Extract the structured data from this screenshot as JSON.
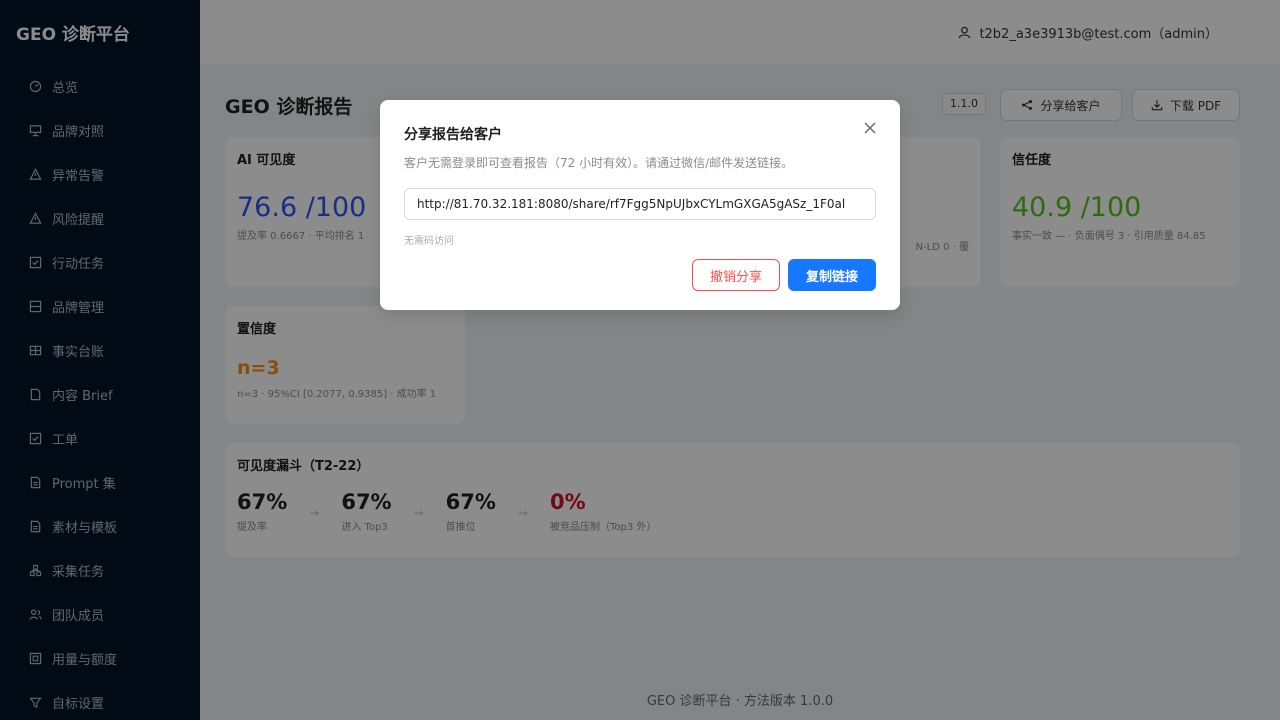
{
  "app": {
    "brand": "GEO 诊断平台"
  },
  "colors": {
    "primary": "#1677ff",
    "danger": "#ff4d4f",
    "visibility_value": "#2f54eb",
    "trust_value": "#52c41a",
    "confidence_value": "#fa8c16",
    "funnel_warning": "#cf1322"
  },
  "sidebar": {
    "items": [
      {
        "label": "总览",
        "icon": "dashboard-icon"
      },
      {
        "label": "品牌对照",
        "icon": "compare-icon"
      },
      {
        "label": "异常告警",
        "icon": "alert-icon"
      },
      {
        "label": "风险提醒",
        "icon": "warning-icon"
      },
      {
        "label": "行动任务",
        "icon": "checkbox-icon"
      },
      {
        "label": "品牌管理",
        "icon": "database-icon"
      },
      {
        "label": "事实台账",
        "icon": "table-icon"
      },
      {
        "label": "内容 Brief",
        "icon": "file-icon"
      },
      {
        "label": "工单",
        "icon": "checkbox-icon"
      },
      {
        "label": "Prompt 集",
        "icon": "document-icon"
      },
      {
        "label": "素材与模板",
        "icon": "document-icon"
      },
      {
        "label": "采集任务",
        "icon": "cluster-icon"
      },
      {
        "label": "团队成员",
        "icon": "team-icon"
      },
      {
        "label": "用量与额度",
        "icon": "quota-icon"
      },
      {
        "label": "自标设置",
        "icon": "settings-icon"
      }
    ]
  },
  "header": {
    "user": "t2b2_a3e3913b@test.com（admin）"
  },
  "page": {
    "title": "GEO 诊断报告",
    "version": "1.1.0",
    "share_label": "分享给客户",
    "download_label": "下载 PDF"
  },
  "cards": {
    "ai_visibility": {
      "title": "AI 可见度",
      "value": "76.6 /100",
      "sub": "提及率 0.6667 · 平均排名 1"
    },
    "middle": {
      "sub": "N-LD 0 · 覆"
    },
    "trust": {
      "title": "信任度",
      "value": "40.9 /100",
      "sub": "事实一致 — · 负面偶号 3 · 引用质量 84.85"
    },
    "confidence": {
      "title": "置信度",
      "value": "n=3",
      "sub": "n=3 · 95%CI [0.2077, 0.9385] · 成功率 1"
    }
  },
  "funnel": {
    "title": "可见度漏斗（T2-22）",
    "arrow": "→",
    "steps": [
      {
        "value": "67%",
        "label": "提及率"
      },
      {
        "value": "67%",
        "label": "进入 Top3"
      },
      {
        "value": "67%",
        "label": "首推位"
      },
      {
        "value": "0%",
        "label": "被竞品压制（Top3 外）"
      }
    ]
  },
  "footer": {
    "text": "GEO 诊断平台 · 方法版本 1.0.0"
  },
  "modal": {
    "title": "分享报告给客户",
    "description": "客户无需登录即可查看报告（72 小时有效）。请通过微信/邮件发送链接。",
    "url": "http://81.70.32.181:8080/share/rf7Fgg5NpUJbxCYLmGXGA5gASz_1F0al",
    "hint": "无需码访问",
    "revoke_label": "撤销分享",
    "copy_label": "复制链接"
  }
}
